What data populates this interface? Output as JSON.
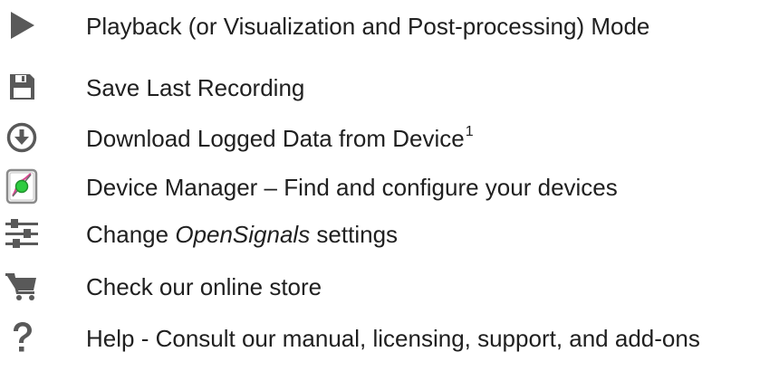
{
  "items": [
    {
      "icon": "play-icon",
      "label": "Playback (or Visualization and Post-processing) Mode"
    },
    {
      "icon": "floppy-disk-save-icon",
      "label": "Save Last Recording"
    },
    {
      "icon": "download-circle-icon",
      "label": "Download Logged Data from Device",
      "superscript": "1"
    },
    {
      "icon": "device-manager-icon",
      "label": "Device Manager – Find and configure your devices"
    },
    {
      "icon": "sliders-settings-icon",
      "label_prefix": "Change ",
      "label_emphasis": "OpenSignals",
      "label_suffix": " settings"
    },
    {
      "icon": "shopping-cart-icon",
      "label": "Check our online store"
    },
    {
      "icon": "question-mark-icon",
      "label": "Help - Consult our manual, licensing, support, and add-ons"
    }
  ],
  "colors": {
    "icon_gray": "#595959",
    "device_frame": "#8a8a8a",
    "device_green": "#2ecc40",
    "device_pink": "#d9468f",
    "text": "#202020"
  }
}
